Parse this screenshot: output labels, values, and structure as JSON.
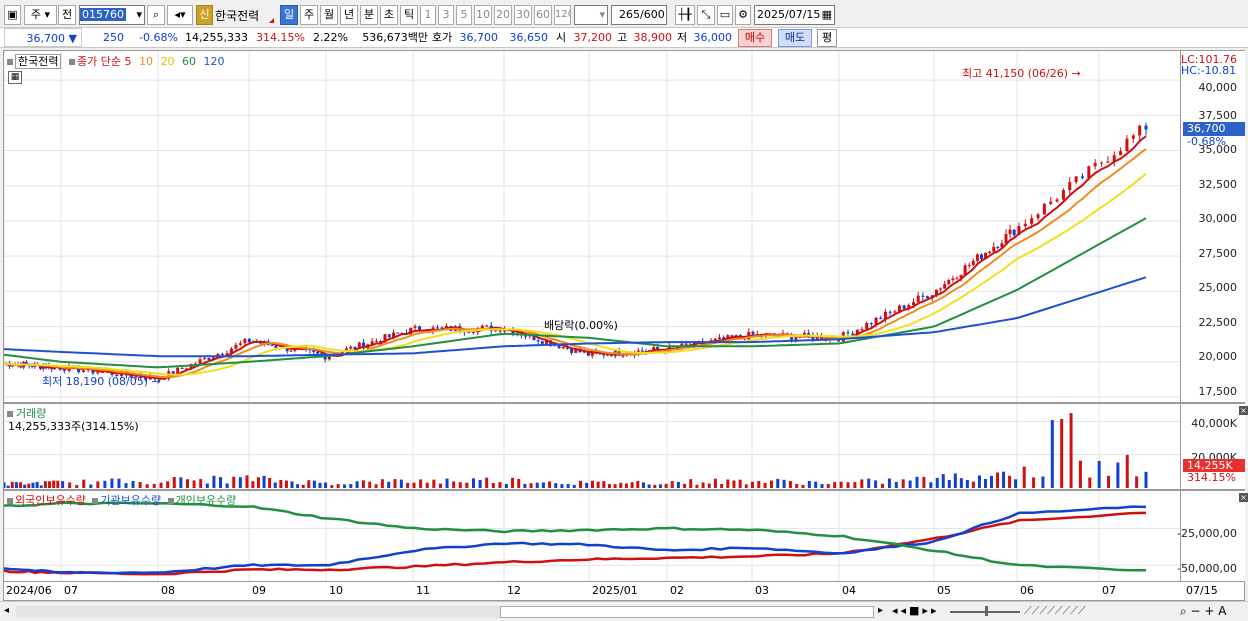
{
  "toolbar": {
    "period_label": "주",
    "prev_label": "전",
    "code": "015760",
    "new_badge": "신",
    "stock_name": "한국전력",
    "period_tabs": [
      "일",
      "주",
      "월",
      "년",
      "분",
      "초",
      "틱"
    ],
    "active_period": "일",
    "interval_buttons": [
      "1",
      "3",
      "5",
      "10",
      "20",
      "30",
      "60",
      "120"
    ],
    "count_value": "265",
    "count_total": "/600",
    "date_value": "2025/07/15"
  },
  "quote": {
    "price": "36,700",
    "arrow": "▼",
    "change": "250",
    "change_pct": "-0.68%",
    "volume": "14,255,333",
    "volume_ratio": "314.15%",
    "turnover_pct": "2.22%",
    "amount": "536,673백만",
    "ask_label": "호가",
    "ask": "36,700",
    "bid": "36,650",
    "open_label": "시",
    "open": "37,200",
    "high_label": "고",
    "high": "38,900",
    "low_label": "저",
    "low": "36,000",
    "buy_label": "매수",
    "sell_label": "매도",
    "avg_label": "평"
  },
  "price_panel": {
    "name_tag": "한국전력",
    "ma_prefix": "종가 단순",
    "ma_periods": [
      "5",
      "10",
      "20",
      "60",
      "120"
    ],
    "lc_label": "LC:101.76",
    "hc_label": "HC:-10.81",
    "high_note": "최고 41,150 (06/26)",
    "low_note": "최저 18,190 (08/05)",
    "dividend_note": "배당락(0.00%)",
    "current_price_tag": "36,700",
    "current_pct_tag": "-0.68%",
    "y_ticks": [
      "40,000",
      "37,500",
      "35,000",
      "32,500",
      "30,000",
      "27,500",
      "25,000",
      "22,500",
      "20,000",
      "17,500"
    ]
  },
  "volume_panel": {
    "title": "거래량",
    "value": "14,255,333주(314.15%)",
    "y_ticks": [
      "40,000K",
      "20,000K"
    ],
    "current_tag": "14,255K",
    "current_pct": "314.15%"
  },
  "holdings_panel": {
    "series": [
      "외국인보유수량",
      "기관보유수량",
      "개인보유수량"
    ],
    "y_ticks": [
      "-25,000,00",
      "-50,000,00"
    ]
  },
  "x_axis": {
    "labels": [
      "2024/06",
      "07",
      "08",
      "09",
      "10",
      "11",
      "12",
      "2025/01",
      "02",
      "03",
      "04",
      "05",
      "06",
      "07"
    ],
    "end_label": "07/15"
  },
  "colors": {
    "up": "#d01010",
    "down": "#1040d0",
    "ma5": "#d01010",
    "ma10": "#f08c1e",
    "ma20": "#f0e020",
    "ma60": "#209040",
    "ma120": "#2050d0",
    "accent": "#3c74d6"
  },
  "chart_data": [
    {
      "type": "line",
      "title": "한국전력",
      "x": [
        "2024/06",
        "07",
        "08",
        "09",
        "10",
        "11",
        "12",
        "2025/01",
        "02",
        "03",
        "04",
        "05",
        "06",
        "07"
      ],
      "ylim": [
        17500,
        41500
      ],
      "series": [
        {
          "name": "종가",
          "values": [
            19900,
            19600,
            18800,
            21500,
            20400,
            22300,
            22400,
            20500,
            20900,
            21900,
            21700,
            25000,
            29500,
            36700
          ]
        },
        {
          "name": "60",
          "values": [
            20500,
            20000,
            19600,
            20000,
            20400,
            21100,
            22000,
            21700,
            21100,
            21100,
            21300,
            22500,
            25100,
            30200
          ]
        },
        {
          "name": "120",
          "values": [
            20900,
            20700,
            20400,
            20400,
            20500,
            20600,
            21100,
            21300,
            21400,
            21400,
            21600,
            22100,
            23100,
            26000
          ]
        }
      ]
    },
    {
      "type": "bar",
      "title": "거래량",
      "categories": [
        "2024/06",
        "07",
        "08",
        "09",
        "10",
        "11",
        "12",
        "2025/01",
        "02",
        "03",
        "04",
        "05",
        "06",
        "07"
      ],
      "values": [
        2500,
        3200,
        4500,
        5500,
        3000,
        4200,
        4800,
        3000,
        3500,
        4200,
        3000,
        5500,
        9000,
        14255
      ],
      "ylabel": "K"
    },
    {
      "type": "line",
      "title": "보유수량",
      "x": [
        "2024/06",
        "07",
        "08",
        "09",
        "10",
        "11",
        "12",
        "2025/01",
        "02",
        "03",
        "04",
        "05",
        "06",
        "07"
      ],
      "series": [
        {
          "name": "외국인보유수량",
          "values": [
            -54,
            -55,
            -56,
            -53,
            -53,
            -51,
            -48,
            -46,
            -45,
            -44,
            -42,
            -32,
            -20,
            -14
          ]
        },
        {
          "name": "기관보유수량",
          "values": [
            -52,
            -55,
            -55,
            -50,
            -50,
            -40,
            -35,
            -36,
            -40,
            -38,
            -42,
            -34,
            -15,
            -10
          ]
        },
        {
          "name": "개인보유수량",
          "values": [
            -10,
            -8,
            -8,
            -10,
            -18,
            -25,
            -27,
            -26,
            -25,
            -26,
            -30,
            -40,
            -50,
            -54
          ]
        }
      ]
    }
  ]
}
